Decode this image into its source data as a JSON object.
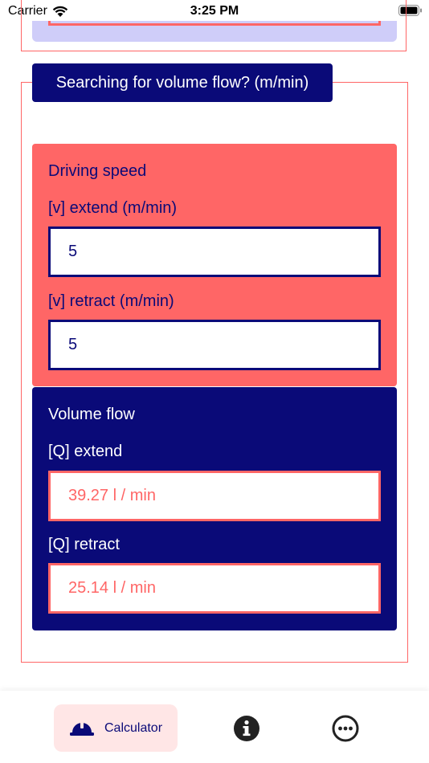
{
  "status_bar": {
    "carrier": "Carrier",
    "time": "3:25 PM"
  },
  "section": {
    "title": "Searching for volume flow? (m/min)"
  },
  "driving_speed": {
    "title": "Driving speed",
    "extend_label": "[v] extend (m/min)",
    "extend_value": "5",
    "retract_label": "[v] retract (m/min)",
    "retract_value": "5"
  },
  "volume_flow": {
    "title": "Volume flow",
    "extend_label": "[Q] extend",
    "extend_value": "39.27 l / min",
    "retract_label": "[Q] retract",
    "retract_value": "25.14 l / min"
  },
  "tabbar": {
    "calculator_label": "Calculator",
    "icons": [
      "helmet-icon",
      "info-icon",
      "more-icon"
    ]
  },
  "colors": {
    "navy": "#0a0a78",
    "coral": "#ff6666",
    "lavender": "#cfcdf9",
    "tab_active_bg": "#ffe6e6"
  }
}
